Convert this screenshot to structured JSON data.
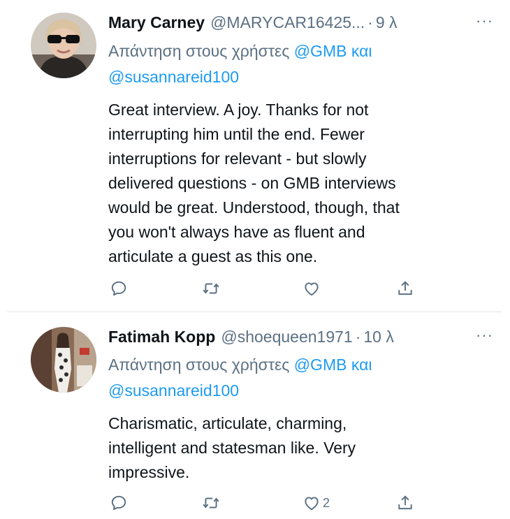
{
  "tweets": [
    {
      "name": "Mary Carney",
      "handle": "@MARYCAR16425...",
      "dot": "·",
      "time": "9 λ",
      "more": "···",
      "reply_prefix": "Απάντηση στους χρήστες",
      "mention_1": "@GMB",
      "conjunction": "και",
      "mention_2": "@susannareid100",
      "text_lines": [
        "Great interview. A joy. Thanks for not",
        "interrupting him until the end. Fewer",
        "interruptions for relevant - but slowly",
        "delivered questions - on GMB interviews",
        "would be great. Understood, though, that",
        "you won't always have as fluent and",
        "articulate a guest as this one."
      ],
      "like_count": ""
    },
    {
      "name": "Fatimah Kopp",
      "handle": "@shoequeen1971",
      "dot": "·",
      "time": "10 λ",
      "more": "···",
      "reply_prefix": "Απάντηση στους χρήστες",
      "mention_1": "@GMB",
      "conjunction": "και",
      "mention_2": "@susannareid100",
      "text_lines": [
        "Charismatic, articulate, charming,",
        "intelligent and statesman like. Very",
        "impressive."
      ],
      "like_count": "2"
    }
  ],
  "colors": {
    "text": "#0f1419",
    "secondary": "#5b7083",
    "link": "#1d9bf0",
    "divider": "#e1e6ea"
  },
  "icons": [
    "reply-icon",
    "retweet-icon",
    "like-icon",
    "share-icon",
    "more-icon"
  ]
}
